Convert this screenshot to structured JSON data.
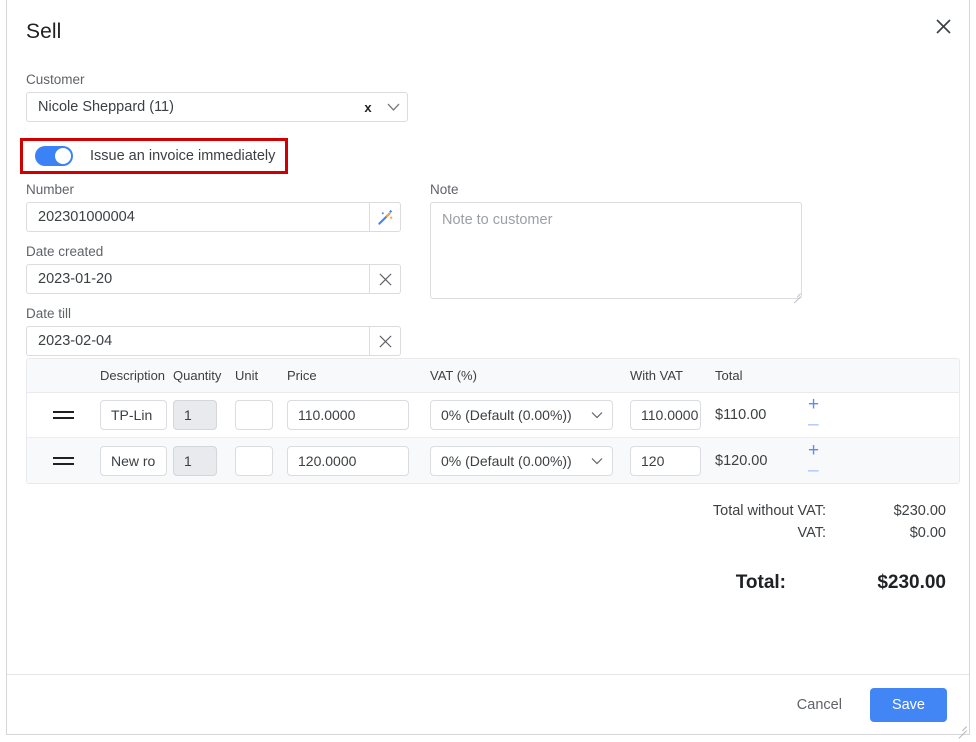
{
  "window": {
    "title": "Sell",
    "close_icon": "close-icon",
    "resize_handle": "resize-grip"
  },
  "customer": {
    "label": "Customer",
    "value": "Nicole Sheppard (11)",
    "clear_icon": "x",
    "caret_icon": "chevron-down-icon"
  },
  "invoice_toggle": {
    "label": "Issue an invoice immediately",
    "state": "on",
    "highlight_color": "#d10000",
    "accent_color": "#3b82f6"
  },
  "number": {
    "label": "Number",
    "value": "202301000004",
    "addon_icon": "magic-wand-icon"
  },
  "date_created": {
    "label": "Date created",
    "value": "2023-01-20",
    "addon_icon": "close-icon"
  },
  "date_till": {
    "label": "Date till",
    "value": "2023-02-04",
    "addon_icon": "close-icon"
  },
  "note": {
    "label": "Note",
    "value": "",
    "placeholder": "Note to customer"
  },
  "table": {
    "columns": [
      "Description",
      "Quantity",
      "Unit",
      "Price",
      "VAT (%)",
      "With VAT",
      "Total"
    ],
    "rows": [
      {
        "description": "TP-Lin",
        "quantity": "1",
        "unit": "",
        "price": "110.0000",
        "vat": "0% (Default (0.00%))",
        "with_vat": "110.0000",
        "total": "$110.00",
        "add_label": "+",
        "remove_label": "–"
      },
      {
        "description": "New ro",
        "quantity": "1",
        "unit": "",
        "price": "120.0000",
        "vat": "0% (Default (0.00%))",
        "with_vat": "120",
        "total": "$120.00",
        "add_label": "+",
        "remove_label": "–"
      }
    ]
  },
  "totals": {
    "without_vat_label": "Total without VAT:",
    "without_vat_value": "$230.00",
    "vat_label": "VAT:",
    "vat_value": "$0.00",
    "grand_label": "Total:",
    "grand_value": "$230.00"
  },
  "footer": {
    "cancel_label": "Cancel",
    "save_label": "Save",
    "save_color": "#4285f4"
  }
}
